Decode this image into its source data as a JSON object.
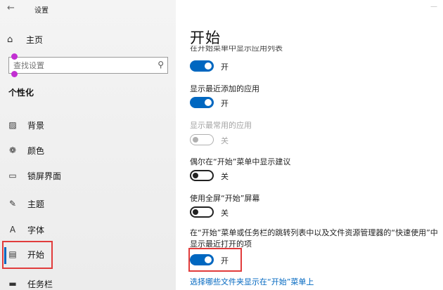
{
  "window": {
    "title": "设置",
    "back_icon": "←"
  },
  "sidebar": {
    "home_label": "主页",
    "search_placeholder": "查找设置",
    "section_title": "个性化",
    "items": [
      {
        "label": "背景",
        "icon": "▨"
      },
      {
        "label": "颜色",
        "icon": "❁"
      },
      {
        "label": "锁屏界面",
        "icon": "▭"
      },
      {
        "label": "主题",
        "icon": "✎"
      },
      {
        "label": "字体",
        "icon": "A"
      },
      {
        "label": "开始",
        "icon": "▤"
      },
      {
        "label": "任务栏",
        "icon": "▬"
      }
    ],
    "active_item": "开始"
  },
  "main": {
    "page_title": "开始",
    "clipped_label": "在开始菜单中显示应用列表",
    "settings": [
      {
        "label": "",
        "state": "开",
        "on": true,
        "enabled": true
      },
      {
        "label": "显示最近添加的应用",
        "state": "开",
        "on": true,
        "enabled": true
      },
      {
        "label": "显示最常用的应用",
        "state": "关",
        "on": false,
        "enabled": false
      },
      {
        "label": "偶尔在“开始”菜单中显示建议",
        "state": "关",
        "on": false,
        "enabled": true
      },
      {
        "label": "使用全屏“开始”屏幕",
        "state": "关",
        "on": false,
        "enabled": true
      },
      {
        "label": "在“开始”菜单或任务栏的跳转列表中以及文件资源管理器的“快速使用”中显示最近打开的项",
        "state": "开",
        "on": true,
        "enabled": true
      }
    ],
    "link_text": "选择哪些文件夹显示在“开始”菜单上"
  },
  "colors": {
    "accent": "#0067c0",
    "highlight_box": "#e13b3b",
    "pin": "#c22fd2"
  }
}
